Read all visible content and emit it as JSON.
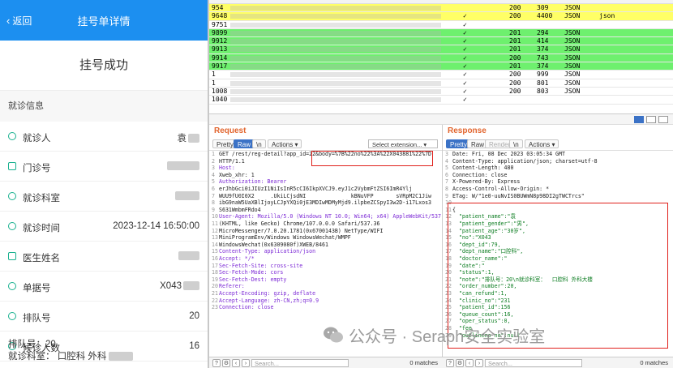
{
  "mobile": {
    "back_label": "返回",
    "title": "挂号单详情",
    "success": "挂号成功",
    "section": "就诊信息",
    "rows": [
      {
        "label": "就诊人",
        "value": "袁"
      },
      {
        "label": "门诊号",
        "value": ""
      },
      {
        "label": "就诊科室",
        "value": ""
      },
      {
        "label": "就诊时间",
        "value": "2023-12-14 16:50:00"
      },
      {
        "label": "医生姓名",
        "value": ""
      },
      {
        "label": "单据号",
        "value": "X043"
      },
      {
        "label": "排队号",
        "value": "20"
      },
      {
        "label": "候诊人数",
        "value": "16"
      }
    ],
    "footer_line1": "排队号：20",
    "footer_line2": "就诊科室：  口腔科 外科"
  },
  "table": {
    "rows": [
      {
        "id": "954",
        "check": "",
        "status": "200",
        "size": "309",
        "mime": "JSON",
        "ext": "",
        "color": "#ffff66"
      },
      {
        "id": "9648",
        "check": "✓",
        "status": "200",
        "size": "4400",
        "mime": "JSON",
        "ext": "json",
        "color": "#ffff66"
      },
      {
        "id": "9751",
        "check": "✓",
        "status": "",
        "size": "",
        "mime": "",
        "ext": "",
        "color": "#ffffff"
      },
      {
        "id": "9899",
        "check": "✓",
        "status": "201",
        "size": "294",
        "mime": "JSON",
        "ext": "",
        "color": "#6ef06e"
      },
      {
        "id": "9912",
        "check": "✓",
        "status": "201",
        "size": "414",
        "mime": "JSON",
        "ext": "",
        "color": "#6ef06e"
      },
      {
        "id": "9913",
        "check": "✓",
        "status": "201",
        "size": "374",
        "mime": "JSON",
        "ext": "",
        "color": "#6ef06e"
      },
      {
        "id": "9914",
        "check": "✓",
        "status": "200",
        "size": "743",
        "mime": "JSON",
        "ext": "",
        "color": "#6ef06e"
      },
      {
        "id": "9917",
        "check": "✓",
        "status": "201",
        "size": "374",
        "mime": "JSON",
        "ext": "",
        "color": "#6ef06e"
      },
      {
        "id": "1",
        "check": "✓",
        "status": "200",
        "size": "999",
        "mime": "JSON",
        "ext": "",
        "color": "#ffffff"
      },
      {
        "id": "1",
        "check": "✓",
        "status": "200",
        "size": "801",
        "mime": "JSON",
        "ext": "",
        "color": "#ffffff"
      },
      {
        "id": "1008",
        "check": "✓",
        "status": "200",
        "size": "803",
        "mime": "JSON",
        "ext": "",
        "color": "#ffffff"
      },
      {
        "id": "1040",
        "check": "✓",
        "status": "",
        "size": "",
        "mime": "",
        "ext": "",
        "color": "#ffffff"
      }
    ]
  },
  "request": {
    "title": "Request",
    "tabs": [
      "Pretty",
      "Raw",
      "\\n",
      "Actions"
    ],
    "active_tab": "Raw",
    "select_placeholder": "Select extension...",
    "lines": [
      "GET /rest/reg-detail?app_id=22&body=%7B%22no%22%3A%22X043881%22%7D",
      "HTTP/1.1",
      "Host:",
      "Xweb_xhr: 1",
      "Authorization: Bearer",
      "erJhbGci0iJIUzI1NiIsInR5cCI6IkpXVCJ9.eyJ1c2VybmFtZSI6ImR4Ylj",
      "WUU9fU0I0X2     .UkiLCjsdNI              kBNuVFP       sVRpM2C1Jiw",
      "ibG9naW5UaXBlIjoyLCJpYXQi0jE3MDIwMDMyMjd9.ilpbeZCSpyI3w2D-i17Lxos3",
      "S631WmbmFRdo4",
      "User-Agent: Mozilla/5.0 (Windows NT 10.0; Win64; x64) AppleWebKit/537.36",
      "(KHTML, like Gecko) Chrome/107.0.0.0 Safari/537.36",
      "MicroMessenger/7.0.20.1781(0x6700143B) NetType/WIFI",
      "MiniProgramEnv/Windows WindowsWechat/WMPF",
      "WindowsWechat(0x6309080f)XWEB/8461",
      "Content-Type: application/json",
      "Accept: */*",
      "Sec-Fetch-Site: cross-site",
      "Sec-Fetch-Mode: cors",
      "Sec-Fetch-Dest: empty",
      "Referer:",
      "Accept-Encoding: gzip, deflate",
      "Accept-Language: zh-CN,zh;q=0.9",
      "Connection: close"
    ],
    "search_placeholder": "Search...",
    "matches": "0 matches"
  },
  "response": {
    "title": "Response",
    "tabs": [
      "Pretty",
      "Raw",
      "Render",
      "\\n",
      "Actions"
    ],
    "active_tab": "Pretty",
    "lines": [
      "Date: Fri, 08 Dec 2023 03:05:34 GMT",
      "Content-Type: application/json; charset=utf-8",
      "Content-Length: 480",
      "Connection: close",
      "X-Powered-By: Express",
      "Access-Control-Allow-Origin: *",
      "ETag: W/\"1e0-uuNvIS0BUWmN8p98DI2gTWCTrcs\"",
      "",
      "{",
      "  \"patient_name\":\"袁",
      "  \"patient_gender\":\"男\",",
      "  \"patient_age\":\"30岁\",",
      "  \"no\":\"X043",
      "  \"dept_id\":79,",
      "  \"dept_name\":\"口腔科\",",
      "  \"doctor_name\":\"",
      "  \"date\":\"",
      "  \"status\":1,",
      "  \"note\":\"排队号：20\\n就诊科室：  口腔科 外科大楼",
      "  \"order_number\":20,",
      "  \"can_refund\":1,",
      "  \"clinic_no\":\"231",
      "  \"patient_id\":156",
      "  \"queue_count\":16,",
      "  \"oper_status\":0,",
      "  \"fee",
      "  \"outlineno_no\":null"
    ],
    "search_placeholder": "Search...",
    "matches": "0 matches"
  },
  "watermark": "公众号 · Seraph安全实验室"
}
